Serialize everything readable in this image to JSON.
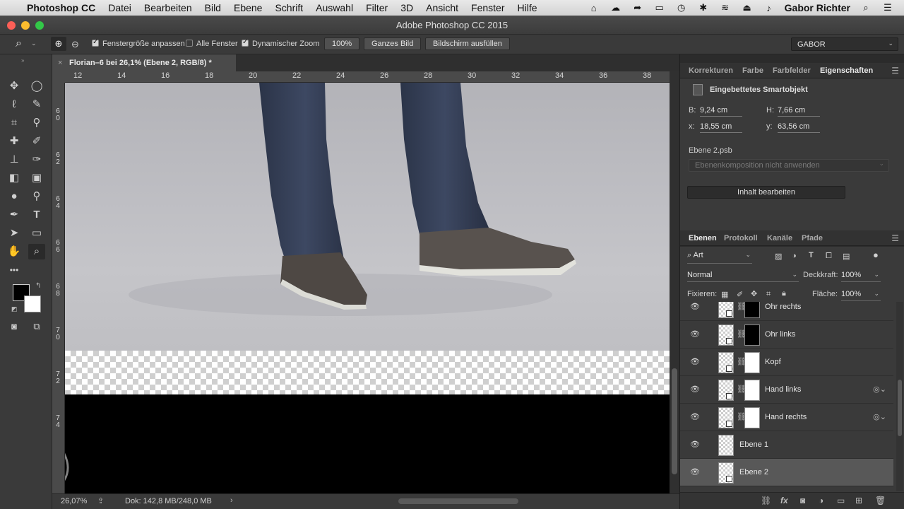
{
  "menubar": {
    "app_name": "Photoshop CC",
    "items": [
      "Datei",
      "Bearbeiten",
      "Bild",
      "Ebene",
      "Schrift",
      "Auswahl",
      "Filter",
      "3D",
      "Ansicht",
      "Fenster",
      "Hilfe"
    ],
    "user": "Gabor Richter"
  },
  "window": {
    "title": "Adobe Photoshop CC 2015"
  },
  "options": {
    "fit_window": "Fenstergröße anpassen",
    "all_windows": "Alle Fenster",
    "scrubby_zoom": "Dynamischer Zoom",
    "zoom_value": "100%",
    "fit_screen": "Ganzes Bild",
    "fill_screen": "Bildschirm ausfüllen",
    "workspace": "GABOR"
  },
  "document": {
    "tab_title": "Florian–6 bei 26,1% (Ebene 2, RGB/8) *",
    "ruler_h": [
      "12",
      "14",
      "16",
      "18",
      "20",
      "22",
      "24",
      "26",
      "28",
      "30",
      "32",
      "34",
      "36",
      "38"
    ],
    "ruler_v": [
      "6\n0",
      "6\n2",
      "6\n4",
      "6\n6",
      "6\n8",
      "7\n0",
      "7\n2",
      "7\n4"
    ]
  },
  "status": {
    "zoom": "26,07%",
    "doc": "Dok: 142,8 MB/248,0 MB"
  },
  "properties_panel": {
    "tabs": [
      "Korrekturen",
      "Farbe",
      "Farbfelder",
      "Eigenschaften"
    ],
    "type": "Eingebettetes Smartobjekt",
    "w_label": "B:",
    "w": "9,24 cm",
    "h_label": "H:",
    "h": "7,66 cm",
    "x_label": "x:",
    "x": "18,55 cm",
    "y_label": "y:",
    "y": "63,56 cm",
    "file": "Ebene 2.psb",
    "comp": "Ebenenkomposition nicht anwenden",
    "edit_button": "Inhalt bearbeiten"
  },
  "layers_panel": {
    "tabs": [
      "Ebenen",
      "Protokoll",
      "Kanäle",
      "Pfade"
    ],
    "filter": "Art",
    "blend": "Normal",
    "opacity_label": "Deckkraft:",
    "opacity": "100%",
    "lock_label": "Fixieren:",
    "fill_label": "Fläche:",
    "fill": "100%",
    "layers": [
      {
        "name": "Ohr rechts"
      },
      {
        "name": "Ohr links"
      },
      {
        "name": "Kopf"
      },
      {
        "name": "Hand links"
      },
      {
        "name": "Hand rechts"
      },
      {
        "name": "Ebene 1"
      },
      {
        "name": "Ebene 2"
      }
    ]
  }
}
